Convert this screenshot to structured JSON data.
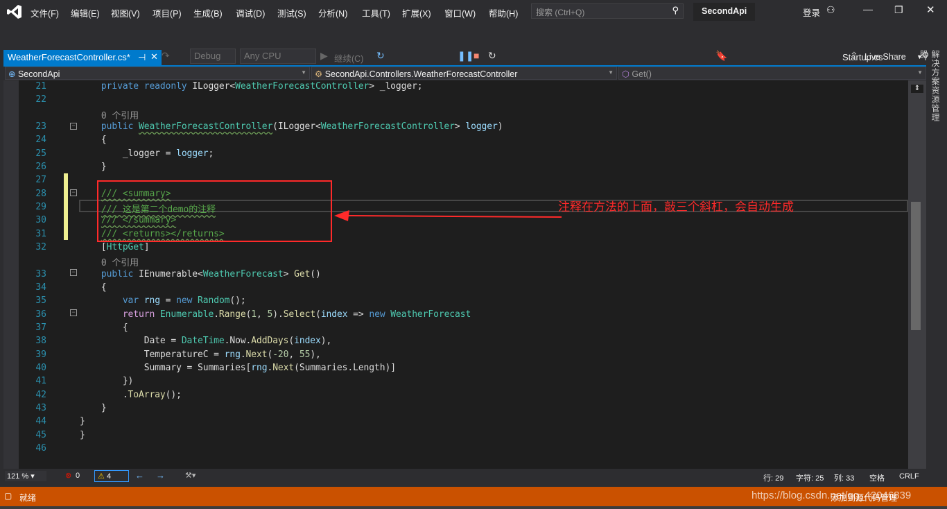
{
  "menu": [
    "文件(F)",
    "编辑(E)",
    "视图(V)",
    "项目(P)",
    "生成(B)",
    "调试(D)",
    "测试(S)",
    "分析(N)",
    "工具(T)",
    "扩展(X)",
    "窗口(W)",
    "帮助(H)"
  ],
  "search_placeholder": "搜索 (Ctrl+Q)",
  "project_name": "SecondApi",
  "login": "登录",
  "toolbar": {
    "config": "Debug",
    "platform": "Any CPU",
    "continue": "继续(C)",
    "live_share": "Live Share"
  },
  "tabs": {
    "active": "WeatherForecastController.cs*",
    "right": "Startup.cs"
  },
  "nav": {
    "project": "SecondApi",
    "class": "SecondApi.Controllers.WeatherForecastController",
    "member": "Get()"
  },
  "side_panel": "解决方案资源管理器",
  "annotation": "注释在方法的上面，敲三个斜杠，会自动生成",
  "code": [
    {
      "n": "21",
      "t": [
        [
          "    private readonly ",
          "k"
        ],
        [
          "ILogger",
          ""
        ],
        [
          "<",
          ""
        ],
        [
          "WeatherForecastController",
          "t"
        ],
        [
          "> _logger;",
          ""
        ]
      ]
    },
    {
      "n": "22",
      "t": []
    },
    {
      "n": "",
      "t": [
        [
          "    0 个引用",
          "r"
        ]
      ]
    },
    {
      "n": "23",
      "t": [
        [
          "    public ",
          "k"
        ],
        [
          "WeatherForecastController",
          "t sq"
        ],
        [
          "(ILogger<",
          ""
        ],
        [
          "WeatherForecastController",
          "t"
        ],
        [
          "> ",
          ""
        ],
        [
          "logger",
          "v"
        ],
        [
          ")",
          ""
        ]
      ]
    },
    {
      "n": "24",
      "t": [
        [
          "    {",
          ""
        ]
      ]
    },
    {
      "n": "25",
      "t": [
        [
          "        _logger = ",
          ""
        ],
        [
          "logger",
          "v"
        ],
        [
          ";",
          ""
        ]
      ]
    },
    {
      "n": "26",
      "t": [
        [
          "    }",
          ""
        ]
      ]
    },
    {
      "n": "27",
      "t": []
    },
    {
      "n": "28",
      "t": [
        [
          "    ",
          ""
        ],
        [
          "/// <summary>",
          "cm sq"
        ]
      ]
    },
    {
      "n": "29",
      "t": [
        [
          "    ",
          ""
        ],
        [
          "/// 这是第二个demo的注释",
          "cm sq"
        ]
      ]
    },
    {
      "n": "30",
      "t": [
        [
          "    ",
          ""
        ],
        [
          "/// </summary>",
          "cm sq"
        ]
      ]
    },
    {
      "n": "31",
      "t": [
        [
          "    ",
          ""
        ],
        [
          "/// <returns></returns>",
          "cm sq"
        ]
      ]
    },
    {
      "n": "32",
      "t": [
        [
          "    [",
          ""
        ],
        [
          "HttpGet",
          "t"
        ],
        [
          "]",
          ""
        ]
      ]
    },
    {
      "n": "",
      "t": [
        [
          "    0 个引用",
          "r"
        ]
      ]
    },
    {
      "n": "33",
      "t": [
        [
          "    public ",
          "k"
        ],
        [
          "IEnumerable<",
          ""
        ],
        [
          "WeatherForecast",
          "t"
        ],
        [
          "> ",
          ""
        ],
        [
          "Get",
          "m"
        ],
        [
          "()",
          ""
        ]
      ]
    },
    {
      "n": "34",
      "t": [
        [
          "    {",
          ""
        ]
      ]
    },
    {
      "n": "35",
      "t": [
        [
          "        var ",
          "k"
        ],
        [
          "rng",
          "v"
        ],
        [
          " = ",
          ""
        ],
        [
          "new ",
          "k"
        ],
        [
          "Random",
          "t"
        ],
        [
          "();",
          ""
        ]
      ]
    },
    {
      "n": "36",
      "t": [
        [
          "        return ",
          "c"
        ],
        [
          "Enumerable",
          "t"
        ],
        [
          ".",
          ""
        ],
        [
          "Range",
          "m"
        ],
        [
          "(",
          ""
        ],
        [
          "1",
          "n"
        ],
        [
          ", ",
          ""
        ],
        [
          "5",
          "n"
        ],
        [
          ").",
          ""
        ],
        [
          "Select",
          "m"
        ],
        [
          "(",
          ""
        ],
        [
          "index",
          "v"
        ],
        [
          " => ",
          ""
        ],
        [
          "new ",
          "k"
        ],
        [
          "WeatherForecast",
          "t"
        ]
      ]
    },
    {
      "n": "37",
      "t": [
        [
          "        {",
          ""
        ]
      ]
    },
    {
      "n": "38",
      "t": [
        [
          "            Date = ",
          ""
        ],
        [
          "DateTime",
          "t"
        ],
        [
          ".Now.",
          ""
        ],
        [
          "AddDays",
          "m"
        ],
        [
          "(",
          ""
        ],
        [
          "index",
          "v"
        ],
        [
          "),",
          ""
        ]
      ]
    },
    {
      "n": "39",
      "t": [
        [
          "            TemperatureC = ",
          ""
        ],
        [
          "rng",
          "v"
        ],
        [
          ".",
          ""
        ],
        [
          "Next",
          "m"
        ],
        [
          "(",
          ""
        ],
        [
          "-20",
          "n"
        ],
        [
          ", ",
          ""
        ],
        [
          "55",
          "n"
        ],
        [
          "),",
          ""
        ]
      ]
    },
    {
      "n": "40",
      "t": [
        [
          "            Summary = Summaries[",
          ""
        ],
        [
          "rng",
          "v"
        ],
        [
          ".",
          ""
        ],
        [
          "Next",
          "m"
        ],
        [
          "(Summaries.Length)]",
          ""
        ]
      ]
    },
    {
      "n": "41",
      "t": [
        [
          "        })",
          ""
        ]
      ]
    },
    {
      "n": "42",
      "t": [
        [
          "        .",
          ""
        ],
        [
          "ToArray",
          "m"
        ],
        [
          "();",
          ""
        ]
      ]
    },
    {
      "n": "43",
      "t": [
        [
          "    }",
          ""
        ]
      ]
    },
    {
      "n": "44",
      "t": [
        [
          "}",
          ""
        ]
      ]
    },
    {
      "n": "45",
      "t": [
        [
          "}",
          ""
        ]
      ]
    },
    {
      "n": "46",
      "t": []
    }
  ],
  "bottom": {
    "zoom": "121 %",
    "errors": "0",
    "warnings": "4",
    "row": "行: 29",
    "char": "字符: 25",
    "col": "列: 33",
    "space": "空格",
    "eol": "CRLF"
  },
  "status": {
    "ready": "就绪",
    "right": "添加到源代码管理",
    "watermark": "https://blog.csdn.net/qq_42046839"
  },
  "colors": {
    "accent": "#007acc",
    "status": "#ca5100",
    "annotation": "#ff2a2a"
  }
}
